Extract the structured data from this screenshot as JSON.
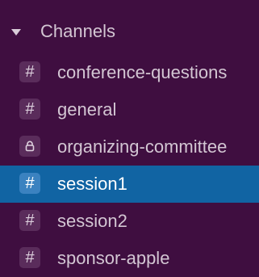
{
  "sidebar": {
    "section": {
      "title": "Channels",
      "expanded": true,
      "caret_icon": "caret-down-icon"
    },
    "channels": [
      {
        "name": "conference-questions",
        "icon": "hash-icon",
        "icon_glyph": "#",
        "selected": false
      },
      {
        "name": "general",
        "icon": "hash-icon",
        "icon_glyph": "#",
        "selected": false
      },
      {
        "name": "organizing-committee",
        "icon": "lock-icon",
        "icon_glyph": "",
        "selected": false
      },
      {
        "name": "session1",
        "icon": "hash-icon",
        "icon_glyph": "#",
        "selected": true
      },
      {
        "name": "session2",
        "icon": "hash-icon",
        "icon_glyph": "#",
        "selected": false
      },
      {
        "name": "sponsor-apple",
        "icon": "hash-icon",
        "icon_glyph": "#",
        "selected": false
      }
    ],
    "colors": {
      "background": "#3f0e40",
      "selected_background": "#1164a3",
      "text": "#d3c6d3",
      "selected_text": "#ffffff"
    }
  }
}
